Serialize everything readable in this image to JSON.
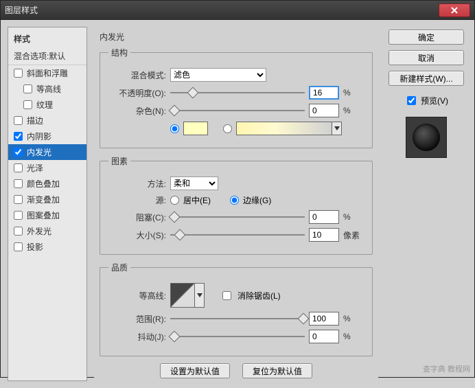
{
  "title": "图层样式",
  "left": {
    "header": "样式",
    "subheader": "混合选项:默认",
    "items": [
      {
        "label": "斜面和浮雕",
        "checked": false,
        "indent": false
      },
      {
        "label": "等高线",
        "checked": false,
        "indent": true
      },
      {
        "label": "纹理",
        "checked": false,
        "indent": true
      },
      {
        "label": "描边",
        "checked": false,
        "indent": false
      },
      {
        "label": "内阴影",
        "checked": true,
        "indent": false
      },
      {
        "label": "内发光",
        "checked": true,
        "indent": false,
        "selected": true
      },
      {
        "label": "光泽",
        "checked": false,
        "indent": false
      },
      {
        "label": "颜色叠加",
        "checked": false,
        "indent": false
      },
      {
        "label": "渐变叠加",
        "checked": false,
        "indent": false
      },
      {
        "label": "图案叠加",
        "checked": false,
        "indent": false
      },
      {
        "label": "外发光",
        "checked": false,
        "indent": false
      },
      {
        "label": "投影",
        "checked": false,
        "indent": false
      }
    ]
  },
  "center": {
    "title": "内发光",
    "structure": {
      "legend": "结构",
      "blend_mode_label": "混合模式:",
      "blend_mode_value": "滤色",
      "opacity_label": "不透明度(O):",
      "opacity_value": "16",
      "noise_label": "杂色(N):",
      "noise_value": "0",
      "percent": "%",
      "color_value": "#ffffc0"
    },
    "elements": {
      "legend": "图素",
      "technique_label": "方法:",
      "technique_value": "柔和",
      "source_label": "源:",
      "source_center": "居中(E)",
      "source_edge": "边缘(G)",
      "choke_label": "阻塞(C):",
      "choke_value": "0",
      "size_label": "大小(S):",
      "size_value": "10",
      "percent": "%",
      "px": "像素"
    },
    "quality": {
      "legend": "品质",
      "contour_label": "等高线:",
      "antialias": "消除锯齿(L)",
      "range_label": "范围(R):",
      "range_value": "100",
      "jitter_label": "抖动(J):",
      "jitter_value": "0",
      "percent": "%"
    },
    "buttons": {
      "make_default": "设置为默认值",
      "reset_default": "复位为默认值"
    }
  },
  "right": {
    "ok": "确定",
    "cancel": "取消",
    "new_style": "新建样式(W)...",
    "preview_label": "预览(V)"
  },
  "watermark": "查字典 教程网"
}
